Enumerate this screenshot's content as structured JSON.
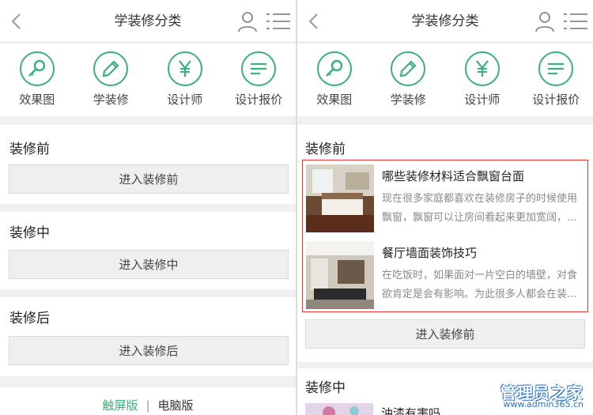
{
  "header": {
    "title": "学装修分类"
  },
  "nav": [
    {
      "label": "效果图",
      "icon": "magnifier-icon"
    },
    {
      "label": "学装修",
      "icon": "pencil-icon"
    },
    {
      "label": "设计师",
      "icon": "yen-icon"
    },
    {
      "label": "设计报价",
      "icon": "list-icon"
    }
  ],
  "left": {
    "sections": [
      {
        "title": "装修前",
        "button": "进入装修前"
      },
      {
        "title": "装修中",
        "button": "进入装修中"
      },
      {
        "title": "装修后",
        "button": "进入装修后"
      }
    ],
    "footer": {
      "touch": "触屏版",
      "sep": "|",
      "pc": "电脑版"
    }
  },
  "right": {
    "section1": {
      "title": "装修前",
      "button": "进入装修前"
    },
    "articles": [
      {
        "title": "哪些装修材料适合飘窗台面",
        "desc": "现在很多家庭都喜欢在装修房子的时候使用飘窗，飘窗可以让房间看起来更加宽阔，..."
      },
      {
        "title": "餐厅墙面装饰技巧",
        "desc": "在吃饭时，如果面对一片空白的墙壁，对食欲肯定是会有影响。为此很多人都会在装..."
      }
    ],
    "section2": {
      "title": "装修中",
      "partial_article_title": "油漆有害吗"
    }
  },
  "watermark": {
    "name": "管理员之家",
    "url": "www.admin365.cn"
  },
  "colors": {
    "accent": "#3ab07a",
    "highlight": "#e33333"
  }
}
